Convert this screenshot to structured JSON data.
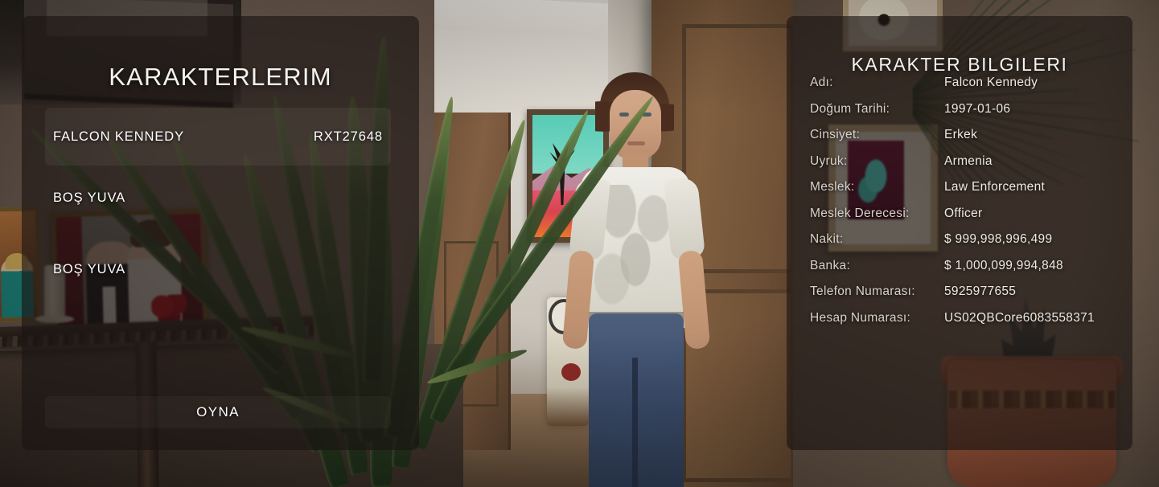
{
  "characters_panel": {
    "title": "KARAKTERLERIM",
    "slots": [
      {
        "name": "FALCON KENNEDY",
        "id": "RXT27648",
        "selected": true
      },
      {
        "name": "BOŞ YUVA",
        "id": "",
        "selected": false
      },
      {
        "name": "BOŞ YUVA",
        "id": "",
        "selected": false
      }
    ],
    "play_button": "OYNA"
  },
  "info_panel": {
    "title": "KARAKTER BILGILERI",
    "rows": [
      {
        "label": "Adı:",
        "value": "Falcon Kennedy"
      },
      {
        "label": "Doğum Tarihi:",
        "value": "1997-01-06"
      },
      {
        "label": "Cinsiyet:",
        "value": "Erkek"
      },
      {
        "label": "Uyruk:",
        "value": "Armenia"
      },
      {
        "label": "Meslek:",
        "value": "Law Enforcement"
      },
      {
        "label": "Meslek Derecesi:",
        "value": "Officer"
      },
      {
        "label": "Nakit:",
        "value": "$ 999,998,996,499"
      },
      {
        "label": "Banka:",
        "value": "$ 1,000,099,994,848"
      },
      {
        "label": "Telefon Numarası:",
        "value": "5925977655"
      },
      {
        "label": "Hesap Numarası:",
        "value": "US02QBCore6083558371"
      }
    ]
  },
  "theme": {
    "panel_bg": "#1a1411",
    "text_primary": "#ffffff",
    "text_label": "#d8d2ca",
    "text_value": "#efe9e1"
  }
}
